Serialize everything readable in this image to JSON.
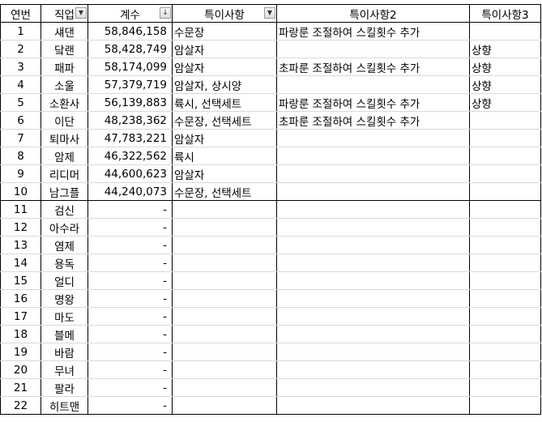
{
  "headers": {
    "num": "연번",
    "job": "직업",
    "value": "계수",
    "note1": "특이사항",
    "note2": "특이사항2",
    "note3": "특이사항3"
  },
  "icons": {
    "filter": "filter-dropdown-icon",
    "sort": "sort-descending-filter-icon"
  },
  "rows": [
    {
      "num": "1",
      "job": "섀댄",
      "value": "58,846,158",
      "note1": "수문장",
      "note2": "파랑룬 조절하여 스킬횟수 추가",
      "note3": ""
    },
    {
      "num": "2",
      "job": "닼랜",
      "value": "58,428,749",
      "note1": "암살자",
      "note2": "",
      "note3": "상향"
    },
    {
      "num": "3",
      "job": "패파",
      "value": "58,174,099",
      "note1": "암살자",
      "note2": "초파룬 조절하여 스킬횟수 추가",
      "note3": "상향"
    },
    {
      "num": "4",
      "job": "소울",
      "value": "57,379,719",
      "note1": "암살자, 상시양",
      "note2": "",
      "note3": "상향"
    },
    {
      "num": "5",
      "job": "소환사",
      "value": "56,139,883",
      "note1": "륙시, 선택세트",
      "note2": "파랑룬 조절하여 스킬횟수 추가",
      "note3": "상향"
    },
    {
      "num": "6",
      "job": "이단",
      "value": "48,238,362",
      "note1": "수문장, 선택세트",
      "note2": "초파룬 조절하여 스킬횟수 추가",
      "note3": ""
    },
    {
      "num": "7",
      "job": "퇴마사",
      "value": "47,783,221",
      "note1": "암살자",
      "note2": "",
      "note3": ""
    },
    {
      "num": "8",
      "job": "암제",
      "value": "46,322,562",
      "note1": "륙시",
      "note2": "",
      "note3": ""
    },
    {
      "num": "9",
      "job": "리디머",
      "value": "44,600,623",
      "note1": "암살자",
      "note2": "",
      "note3": ""
    },
    {
      "num": "10",
      "job": "남그플",
      "value": "44,240,073",
      "note1": "수문장, 선택세트",
      "note2": "",
      "note3": ""
    },
    {
      "num": "11",
      "job": "검신",
      "value": "-",
      "note1": "",
      "note2": "",
      "note3": ""
    },
    {
      "num": "12",
      "job": "아수라",
      "value": "-",
      "note1": "",
      "note2": "",
      "note3": ""
    },
    {
      "num": "13",
      "job": "염제",
      "value": "-",
      "note1": "",
      "note2": "",
      "note3": ""
    },
    {
      "num": "14",
      "job": "용독",
      "value": "-",
      "note1": "",
      "note2": "",
      "note3": ""
    },
    {
      "num": "15",
      "job": "얼디",
      "value": "-",
      "note1": "",
      "note2": "",
      "note3": ""
    },
    {
      "num": "16",
      "job": "명왕",
      "value": "-",
      "note1": "",
      "note2": "",
      "note3": ""
    },
    {
      "num": "17",
      "job": "마도",
      "value": "-",
      "note1": "",
      "note2": "",
      "note3": ""
    },
    {
      "num": "18",
      "job": "블메",
      "value": "-",
      "note1": "",
      "note2": "",
      "note3": ""
    },
    {
      "num": "19",
      "job": "바람",
      "value": "-",
      "note1": "",
      "note2": "",
      "note3": ""
    },
    {
      "num": "20",
      "job": "무녀",
      "value": "-",
      "note1": "",
      "note2": "",
      "note3": ""
    },
    {
      "num": "21",
      "job": "팔라",
      "value": "-",
      "note1": "",
      "note2": "",
      "note3": ""
    },
    {
      "num": "22",
      "job": "히트맨",
      "value": "-",
      "note1": "",
      "note2": "",
      "note3": ""
    }
  ]
}
